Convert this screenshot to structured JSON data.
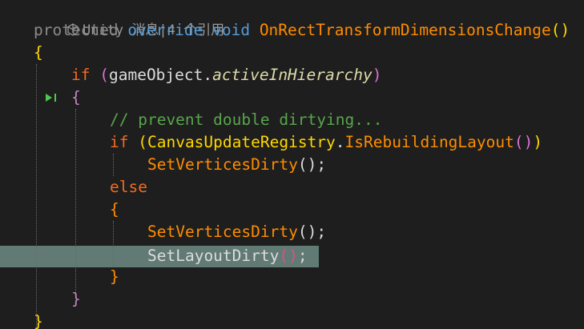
{
  "codelens": {
    "prefix": "Unity 消息",
    "separator": "|",
    "references": "4 个引用"
  },
  "tokens": {
    "protected": "protected",
    "override": "override",
    "void": "void",
    "method_name": "OnRectTransformDimensionsChange",
    "parens": "()",
    "open_brace": "{",
    "close_brace": "}",
    "if_kw": "if",
    "open_paren": "(",
    "close_paren": ")",
    "game_object": "gameObject",
    "dot": ".",
    "active_in_hierarchy": "activeInHierarchy",
    "comment": "// prevent double dirtying...",
    "canvas_update_registry": "CanvasUpdateRegistry",
    "is_rebuilding_layout": "IsRebuildingLayout",
    "set_vertices_dirty": "SetVerticesDirty",
    "set_layout_dirty": "SetLayoutDirty",
    "semicolon": ";",
    "else_kw": "else"
  },
  "colors": {
    "background": "#1e1e1e",
    "current_line_highlight": "#617a74",
    "keyword_blue": "#569cd6",
    "method_orange": "#ff8c00",
    "type_yellow": "#ffd700",
    "comment_green": "#57a64a"
  }
}
